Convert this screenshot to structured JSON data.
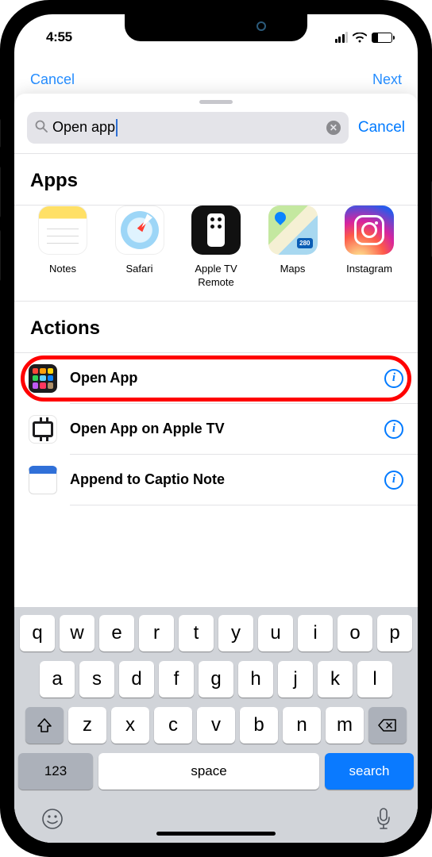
{
  "status": {
    "time": "4:55"
  },
  "bg_sheet": {
    "left": "Cancel",
    "right": "Next"
  },
  "search": {
    "value": "Open app",
    "cancel": "Cancel"
  },
  "sections": {
    "apps": "Apps",
    "actions": "Actions"
  },
  "apps": [
    {
      "name": "Notes",
      "icon": "notes"
    },
    {
      "name": "Safari",
      "icon": "safari"
    },
    {
      "name": "Apple TV Remote",
      "icon": "tv-remote"
    },
    {
      "name": "Maps",
      "icon": "maps"
    },
    {
      "name": "Instagram",
      "icon": "instagram"
    }
  ],
  "actions": [
    {
      "label": "Open App",
      "icon": "open-app",
      "highlighted": true
    },
    {
      "label": "Open App on Apple TV",
      "icon": "apple-tv"
    },
    {
      "label": "Append to Captio Note",
      "icon": "captio"
    }
  ],
  "keyboard": {
    "row1": [
      "q",
      "w",
      "e",
      "r",
      "t",
      "y",
      "u",
      "i",
      "o",
      "p"
    ],
    "row2": [
      "a",
      "s",
      "d",
      "f",
      "g",
      "h",
      "j",
      "k",
      "l"
    ],
    "row3": [
      "z",
      "x",
      "c",
      "v",
      "b",
      "n",
      "m"
    ],
    "numkey": "123",
    "space": "space",
    "action": "search"
  }
}
